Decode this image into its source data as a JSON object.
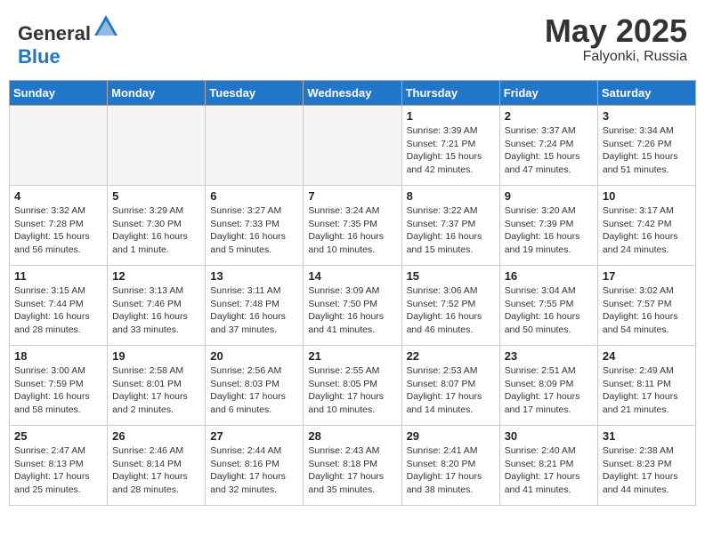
{
  "header": {
    "logo_general": "General",
    "logo_blue": "Blue",
    "month": "May 2025",
    "location": "Falyonki, Russia"
  },
  "days_of_week": [
    "Sunday",
    "Monday",
    "Tuesday",
    "Wednesday",
    "Thursday",
    "Friday",
    "Saturday"
  ],
  "weeks": [
    [
      {
        "day": "",
        "info": ""
      },
      {
        "day": "",
        "info": ""
      },
      {
        "day": "",
        "info": ""
      },
      {
        "day": "",
        "info": ""
      },
      {
        "day": "1",
        "info": "Sunrise: 3:39 AM\nSunset: 7:21 PM\nDaylight: 15 hours\nand 42 minutes."
      },
      {
        "day": "2",
        "info": "Sunrise: 3:37 AM\nSunset: 7:24 PM\nDaylight: 15 hours\nand 47 minutes."
      },
      {
        "day": "3",
        "info": "Sunrise: 3:34 AM\nSunset: 7:26 PM\nDaylight: 15 hours\nand 51 minutes."
      }
    ],
    [
      {
        "day": "4",
        "info": "Sunrise: 3:32 AM\nSunset: 7:28 PM\nDaylight: 15 hours\nand 56 minutes."
      },
      {
        "day": "5",
        "info": "Sunrise: 3:29 AM\nSunset: 7:30 PM\nDaylight: 16 hours\nand 1 minute."
      },
      {
        "day": "6",
        "info": "Sunrise: 3:27 AM\nSunset: 7:33 PM\nDaylight: 16 hours\nand 5 minutes."
      },
      {
        "day": "7",
        "info": "Sunrise: 3:24 AM\nSunset: 7:35 PM\nDaylight: 16 hours\nand 10 minutes."
      },
      {
        "day": "8",
        "info": "Sunrise: 3:22 AM\nSunset: 7:37 PM\nDaylight: 16 hours\nand 15 minutes."
      },
      {
        "day": "9",
        "info": "Sunrise: 3:20 AM\nSunset: 7:39 PM\nDaylight: 16 hours\nand 19 minutes."
      },
      {
        "day": "10",
        "info": "Sunrise: 3:17 AM\nSunset: 7:42 PM\nDaylight: 16 hours\nand 24 minutes."
      }
    ],
    [
      {
        "day": "11",
        "info": "Sunrise: 3:15 AM\nSunset: 7:44 PM\nDaylight: 16 hours\nand 28 minutes."
      },
      {
        "day": "12",
        "info": "Sunrise: 3:13 AM\nSunset: 7:46 PM\nDaylight: 16 hours\nand 33 minutes."
      },
      {
        "day": "13",
        "info": "Sunrise: 3:11 AM\nSunset: 7:48 PM\nDaylight: 16 hours\nand 37 minutes."
      },
      {
        "day": "14",
        "info": "Sunrise: 3:09 AM\nSunset: 7:50 PM\nDaylight: 16 hours\nand 41 minutes."
      },
      {
        "day": "15",
        "info": "Sunrise: 3:06 AM\nSunset: 7:52 PM\nDaylight: 16 hours\nand 46 minutes."
      },
      {
        "day": "16",
        "info": "Sunrise: 3:04 AM\nSunset: 7:55 PM\nDaylight: 16 hours\nand 50 minutes."
      },
      {
        "day": "17",
        "info": "Sunrise: 3:02 AM\nSunset: 7:57 PM\nDaylight: 16 hours\nand 54 minutes."
      }
    ],
    [
      {
        "day": "18",
        "info": "Sunrise: 3:00 AM\nSunset: 7:59 PM\nDaylight: 16 hours\nand 58 minutes."
      },
      {
        "day": "19",
        "info": "Sunrise: 2:58 AM\nSunset: 8:01 PM\nDaylight: 17 hours\nand 2 minutes."
      },
      {
        "day": "20",
        "info": "Sunrise: 2:56 AM\nSunset: 8:03 PM\nDaylight: 17 hours\nand 6 minutes."
      },
      {
        "day": "21",
        "info": "Sunrise: 2:55 AM\nSunset: 8:05 PM\nDaylight: 17 hours\nand 10 minutes."
      },
      {
        "day": "22",
        "info": "Sunrise: 2:53 AM\nSunset: 8:07 PM\nDaylight: 17 hours\nand 14 minutes."
      },
      {
        "day": "23",
        "info": "Sunrise: 2:51 AM\nSunset: 8:09 PM\nDaylight: 17 hours\nand 17 minutes."
      },
      {
        "day": "24",
        "info": "Sunrise: 2:49 AM\nSunset: 8:11 PM\nDaylight: 17 hours\nand 21 minutes."
      }
    ],
    [
      {
        "day": "25",
        "info": "Sunrise: 2:47 AM\nSunset: 8:13 PM\nDaylight: 17 hours\nand 25 minutes."
      },
      {
        "day": "26",
        "info": "Sunrise: 2:46 AM\nSunset: 8:14 PM\nDaylight: 17 hours\nand 28 minutes."
      },
      {
        "day": "27",
        "info": "Sunrise: 2:44 AM\nSunset: 8:16 PM\nDaylight: 17 hours\nand 32 minutes."
      },
      {
        "day": "28",
        "info": "Sunrise: 2:43 AM\nSunset: 8:18 PM\nDaylight: 17 hours\nand 35 minutes."
      },
      {
        "day": "29",
        "info": "Sunrise: 2:41 AM\nSunset: 8:20 PM\nDaylight: 17 hours\nand 38 minutes."
      },
      {
        "day": "30",
        "info": "Sunrise: 2:40 AM\nSunset: 8:21 PM\nDaylight: 17 hours\nand 41 minutes."
      },
      {
        "day": "31",
        "info": "Sunrise: 2:38 AM\nSunset: 8:23 PM\nDaylight: 17 hours\nand 44 minutes."
      }
    ]
  ]
}
